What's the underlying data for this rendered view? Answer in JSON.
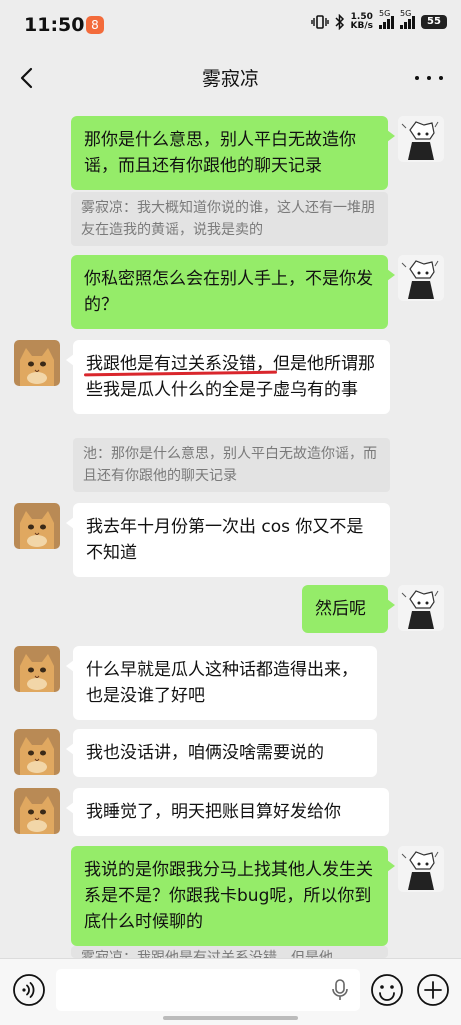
{
  "status": {
    "time": "11:50",
    "notif_badge": "8",
    "net_speed": "1.50",
    "net_unit": "KB/s",
    "sig1": "5G",
    "sig2": "5G",
    "battery": "55"
  },
  "header": {
    "title": "雾寂凉"
  },
  "messages": [
    {
      "side": "me",
      "text": "那你是什么意思，别人平白无故造你谣，而且还有你跟他的聊天记录"
    },
    {
      "quote": "雾寂凉：我大概知道你说的谁，这人还有一堆朋友在造我的黄谣，说我是卖的"
    },
    {
      "side": "me",
      "text": "你私密照怎么会在别人手上，不是你发的？"
    },
    {
      "side": "other",
      "text_underlined": "我跟他是有过关系没错，",
      "text_rest": "但是他所谓那些我是瓜人什么的全是子虚乌有的事"
    },
    {
      "quote": "池：那你是什么意思，别人平白无故造你谣，而且还有你跟他的聊天记录"
    },
    {
      "side": "other",
      "text": "我去年十月份第一次出 cos 你又不是不知道"
    },
    {
      "side": "me",
      "text": "然后呢"
    },
    {
      "side": "other",
      "text": "什么早就是瓜人这种话都造得出来，也是没谁了好吧"
    },
    {
      "side": "other",
      "text": "我也没话讲，咱俩没啥需要说的"
    },
    {
      "side": "other",
      "text": "我睡觉了，明天把账目算好发给你"
    },
    {
      "side": "me",
      "text": "我说的是你跟我分马上找其他人发生关系是不是？你跟我卡bug呢，所以你到底什么时候聊的"
    },
    {
      "quote": "雾寂凉：我跟他是有过关系没错，但是他"
    }
  ],
  "icons": {
    "back": "back-arrow-icon",
    "more": "more-dots-icon",
    "voice": "voice-icon",
    "mic": "microphone-icon",
    "emoji": "emoji-icon",
    "plus": "plus-icon"
  },
  "colors": {
    "me_bubble": "#95ec69",
    "other_bubble": "#ffffff",
    "background": "#ededed",
    "underline": "#d9262c"
  }
}
